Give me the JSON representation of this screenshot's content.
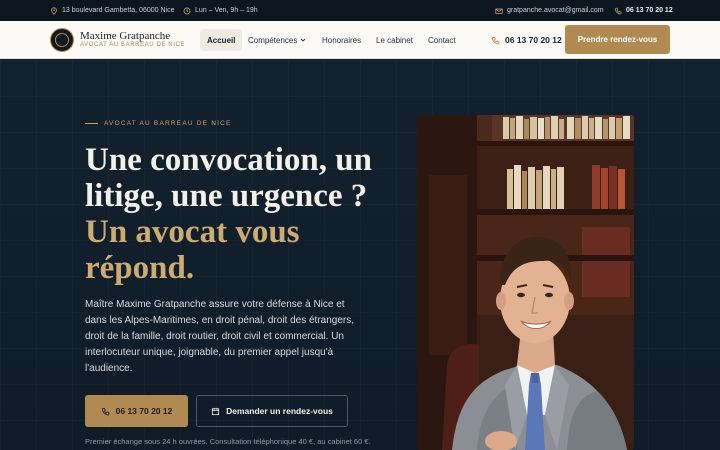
{
  "topbar": {
    "address": "13 boulevard Gambetta, 06000 Nice",
    "hours": "Lun – Ven, 9h – 19h",
    "email": "gratpanche.avocat@gmail.com",
    "phone": "06 13 70 20 12"
  },
  "header": {
    "logo_name": "Maxime Gratpanche",
    "logo_tagline": "AVOCAT AU BARREAU DE NICE",
    "nav": [
      "Accueil",
      "Compétences",
      "Honoraires",
      "Le cabinet",
      "Contact"
    ],
    "phone": "06 13 70 20 12",
    "cta_label": "Prendre rendez-vous"
  },
  "hero": {
    "eyebrow": "AVOCAT AU BARREAU DE NICE",
    "headline_line1": "Une convocation, un litige, une urgence ?",
    "headline_line2": "Un avocat vous répond.",
    "lead": "Maître Maxime Gratpanche assure votre défense à Nice et dans les Alpes-Maritimes, en droit pénal, droit des étrangers, droit de la famille, droit routier, droit civil et commercial. Un interlocuteur unique, joignable, du premier appel jusqu'à l'audience.",
    "call_button": "06 13 70 20 12",
    "appointment_button": "Demander un rendez-vous",
    "note": "Premier échange sous 24 h ouvrées. Consultation téléphonique 40 €, au cabinet 60 €."
  },
  "colors": {
    "accent": "#b08a52",
    "gold_text": "#cdab72",
    "navy": "#0f1b27"
  },
  "icons": {
    "address": "map-pin-icon",
    "hours": "clock-icon",
    "email": "mail-icon",
    "phone": "phone-icon",
    "calendar": "calendar-icon",
    "dropdown": "chevron-down-icon"
  }
}
